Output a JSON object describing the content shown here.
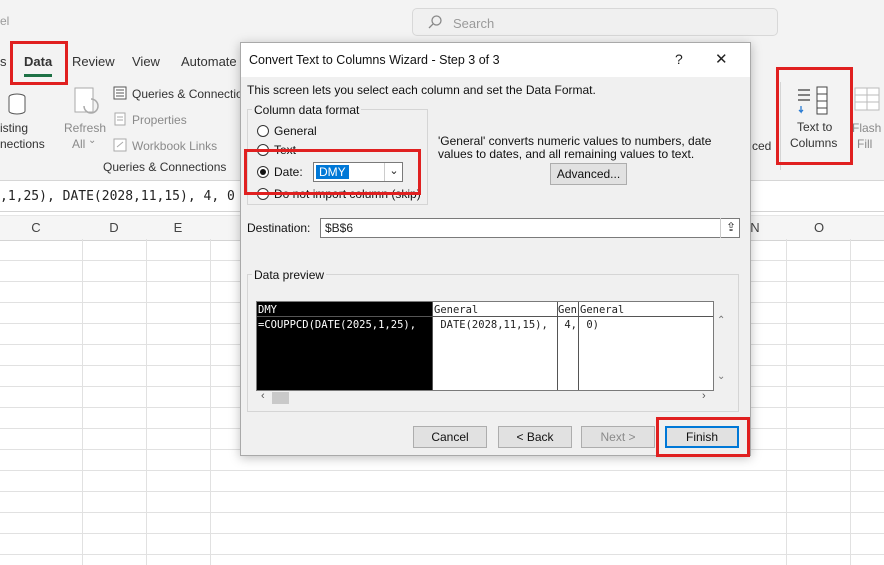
{
  "app": {
    "name": "el"
  },
  "search": {
    "placeholder": "Search"
  },
  "tabs": [
    {
      "label": "s"
    },
    {
      "label": "Data"
    },
    {
      "label": "Review"
    },
    {
      "label": "View"
    },
    {
      "label": "Automate"
    }
  ],
  "ribbon": {
    "existing_line1": "isting",
    "existing_line2": "nections",
    "refresh_line1": "Refresh",
    "refresh_line2": "All",
    "queries": "Queries & Connectio",
    "properties": "Properties",
    "workbook_links": "Workbook Links",
    "group_label": "Queries & Connections",
    "advanced_partial": "ced",
    "text_to_columns_line1": "Text to",
    "text_to_columns_line2": "Columns",
    "flash_fill_line1": "Flash",
    "flash_fill_line2": "Fill"
  },
  "formula_bar": {
    "text": ",1,25), DATE(2028,11,15), 4, 0"
  },
  "columns": [
    "C",
    "D",
    "E",
    "N",
    "O"
  ],
  "dialog": {
    "title": "Convert Text to Columns Wizard - Step 3 of 3",
    "help": "?",
    "close": "✕",
    "intro": "This screen lets you select each column and set the Data Format.",
    "format_group_label": "Column data format",
    "options": {
      "general": "General",
      "text": "Text",
      "date": "Date:",
      "skip": "Do not import column (skip)"
    },
    "selected_option": "date",
    "date_format": "DMY",
    "description": "'General' converts numeric values to numbers, date values to dates, and all remaining values to text.",
    "advanced_button": "Advanced...",
    "destination_label": "Destination:",
    "destination_value": "$B$6",
    "preview_label": "Data preview",
    "preview_headers": [
      "DMY",
      "General",
      "Gen",
      "General"
    ],
    "preview_row": [
      "=COUPPCD(DATE(2025,1,25),",
      " DATE(2028,11,15),",
      " 4,",
      " 0)"
    ],
    "buttons": {
      "cancel": "Cancel",
      "back": "< Back",
      "next": "Next >",
      "finish": "Finish"
    }
  },
  "colors": {
    "highlight": "#e02020",
    "accent": "#0078d7",
    "dialog_bg": "#f0f0f0"
  }
}
